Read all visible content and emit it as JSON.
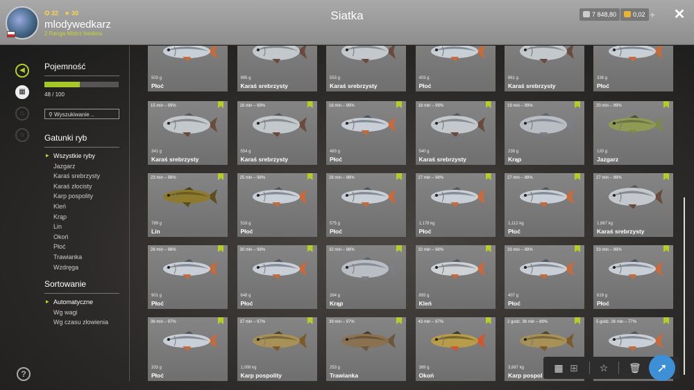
{
  "header": {
    "title": "Siatka",
    "level_value": "32",
    "star_value": "30",
    "username": "mlodywedkarz",
    "rank": "2 Ranga Mistrz feedera",
    "silver": "7 848,80",
    "gold": "0,02",
    "plus_label": "+",
    "close_label": "✕"
  },
  "sidebar": {
    "capacity_title": "Pojemność",
    "capacity_fraction": 0.48,
    "capacity_text": "48 / 100",
    "search_placeholder": "Wyszukiwanie ..",
    "species_title": "Gatunki ryb",
    "species": [
      "Wszystkie ryby",
      "Jazgarz",
      "Karaś srebrzysty",
      "Karaś złocisty",
      "Karp pospolity",
      "Kleń",
      "Krąp",
      "Lin",
      "Okoń",
      "Płoć",
      "Trawianka",
      "Wzdręga"
    ],
    "sort_title": "Sortowanie",
    "sort_options": [
      "Automatyczne",
      "Wg wagi",
      "Wg czasu złowienia"
    ],
    "help_label": "?"
  },
  "colors": {
    "accent": "#b5cc2b",
    "action_blue": "#3d8fd6"
  },
  "cards": [
    {
      "time": "",
      "weight": "503 g",
      "name": "Płoć",
      "fish": "roach"
    },
    {
      "time": "",
      "weight": "995 g",
      "name": "Karaś srebrzysty",
      "fish": "crucian"
    },
    {
      "time": "",
      "weight": "553 g",
      "name": "Karaś srebrzysty",
      "fish": "crucian"
    },
    {
      "time": "",
      "weight": "403 g",
      "name": "Płoć",
      "fish": "roach"
    },
    {
      "time": "",
      "weight": "861 g",
      "name": "Karaś srebrzysty",
      "fish": "crucian"
    },
    {
      "time": "",
      "weight": "338 g",
      "name": "Płoć",
      "fish": "roach"
    },
    {
      "time": "15 min – 99%",
      "weight": "341 g",
      "name": "Karaś srebrzysty",
      "fish": "crucian"
    },
    {
      "time": "16 min – 99%",
      "weight": "554 g",
      "name": "Karaś srebrzysty",
      "fish": "crucian"
    },
    {
      "time": "16 min – 99%",
      "weight": "483 g",
      "name": "Płoć",
      "fish": "roach"
    },
    {
      "time": "18 min – 99%",
      "weight": "540 g",
      "name": "Karaś srebrzysty",
      "fish": "crucian"
    },
    {
      "time": "19 min – 99%",
      "weight": "238 g",
      "name": "Krąp",
      "fish": "bream"
    },
    {
      "time": "20 min – 99%",
      "weight": "120 g",
      "name": "Jazgarz",
      "fish": "ruffe"
    },
    {
      "time": "23 min – 98%",
      "weight": "789 g",
      "name": "Lin",
      "fish": "tench"
    },
    {
      "time": "25 min – 98%",
      "weight": "518 g",
      "name": "Płoć",
      "fish": "roach"
    },
    {
      "time": "26 min – 98%",
      "weight": "575 g",
      "name": "Płoć",
      "fish": "roach"
    },
    {
      "time": "27 min – 98%",
      "weight": "1,178 kg",
      "name": "Płoć",
      "fish": "roach"
    },
    {
      "time": "27 min – 98%",
      "weight": "1,112 kg",
      "name": "Płoć",
      "fish": "roach"
    },
    {
      "time": "27 min – 98%",
      "weight": "1,867 kg",
      "name": "Karaś srebrzysty",
      "fish": "crucian"
    },
    {
      "time": "28 min – 98%",
      "weight": "901 g",
      "name": "Płoć",
      "fish": "roach"
    },
    {
      "time": "30 min – 98%",
      "weight": "648 g",
      "name": "Płoć",
      "fish": "roach"
    },
    {
      "time": "32 min – 98%",
      "weight": "264 g",
      "name": "Krąp",
      "fish": "bream"
    },
    {
      "time": "32 min – 98%",
      "weight": "893 g",
      "name": "Kleń",
      "fish": "chub"
    },
    {
      "time": "33 min – 98%",
      "weight": "407 g",
      "name": "Płoć",
      "fish": "roach"
    },
    {
      "time": "33 min – 98%",
      "weight": "619 g",
      "name": "Płoć",
      "fish": "roach"
    },
    {
      "time": "36 min – 97%",
      "weight": "333 g",
      "name": "Płoć",
      "fish": "roach"
    },
    {
      "time": "37 min – 97%",
      "weight": "1,008 kg",
      "name": "Karp pospolity",
      "fish": "carp"
    },
    {
      "time": "39 min – 97%",
      "weight": "253 g",
      "name": "Trawianka",
      "fish": "goby"
    },
    {
      "time": "43 min – 97%",
      "weight": "369 g",
      "name": "Okoń",
      "fish": "perch"
    },
    {
      "time": "2 godz. 36 min – 89%",
      "weight": "3,887 kg",
      "name": "Karp pospol",
      "fish": "carp"
    },
    {
      "time": "5 godz. 26 min – 77%",
      "weight": "",
      "name": "",
      "fish": "roach"
    }
  ]
}
